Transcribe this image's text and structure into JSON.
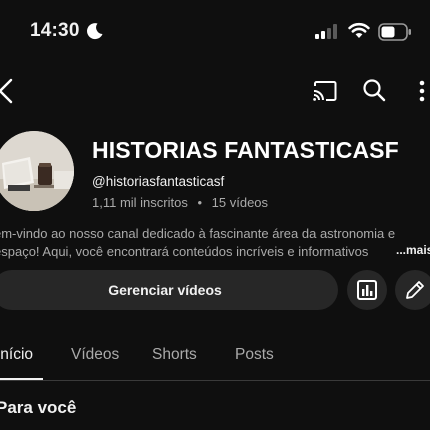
{
  "status_bar": {
    "time": "14:30"
  },
  "channel": {
    "name": "HISTORIAS FANTASTICASF",
    "handle": "@historiasfantasticasf",
    "subscribers": "1,11 mil inscritos",
    "separator": "•",
    "videos": "15 vídeos",
    "description_line1": "em-vindo ao nosso canal dedicado à fascinante área da astronomia e",
    "description_line2": "espaço! Aqui, você encontrará conteúdos incríveis e informativos",
    "more_label": "...mais"
  },
  "actions": {
    "manage_label": "Gerenciar vídeos"
  },
  "tabs": [
    {
      "label": "Início",
      "active": true
    },
    {
      "label": "Vídeos",
      "active": false
    },
    {
      "label": "Shorts",
      "active": false
    },
    {
      "label": "Posts",
      "active": false
    }
  ],
  "section": {
    "title": "Para você"
  },
  "icons": {
    "moon": "moon-icon",
    "signal": "cellular-signal-icon",
    "wifi": "wifi-icon",
    "battery": "battery-icon",
    "back": "back-arrow-icon",
    "cast": "cast-icon",
    "search": "search-icon",
    "more": "more-vertical-icon",
    "analytics": "analytics-icon",
    "edit": "pencil-icon"
  },
  "colors": {
    "background": "#0f0f0f",
    "text": "#f1f1f1",
    "secondary": "#aaaaaa",
    "button": "#272727"
  }
}
